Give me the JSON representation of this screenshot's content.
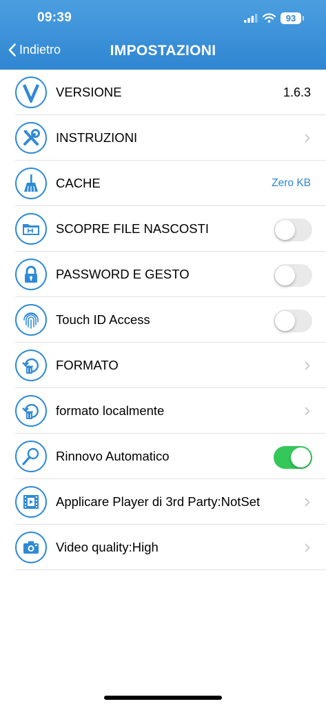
{
  "status_bar": {
    "time": "09:39",
    "battery": "93"
  },
  "nav": {
    "back_label": "Indietro",
    "title": "IMPOSTAZIONI"
  },
  "rows": [
    {
      "label": "VERSIONE",
      "value": "1.6.3",
      "icon": "version-v-icon"
    },
    {
      "label": "INSTRUZIONI",
      "icon": "tools-icon"
    },
    {
      "label": "CACHE",
      "value": "Zero KB",
      "icon": "broom-icon"
    },
    {
      "label": "SCOPRE FILE NASCOSTI",
      "icon": "hidden-folder-icon",
      "toggle_on": false
    },
    {
      "label": "PASSWORD E GESTO",
      "icon": "lock-icon",
      "toggle_on": false
    },
    {
      "label": "Touch ID Access",
      "icon": "fingerprint-icon",
      "toggle_on": false
    },
    {
      "label": "FORMATO",
      "icon": "format-trash-icon"
    },
    {
      "label": "formato localmente",
      "icon": "format-local-icon"
    },
    {
      "label": "Rinnovo Automatico",
      "icon": "magnifier-icon",
      "toggle_on": true
    },
    {
      "label": "Applicare Player di 3rd Party:NotSet",
      "icon": "film-player-icon"
    },
    {
      "label": "Video quality:High",
      "icon": "camera-icon"
    }
  ],
  "colors": {
    "accent": "#2f86d1",
    "toggle_on": "#34c759",
    "toggle_off": "#e9e9ea"
  }
}
